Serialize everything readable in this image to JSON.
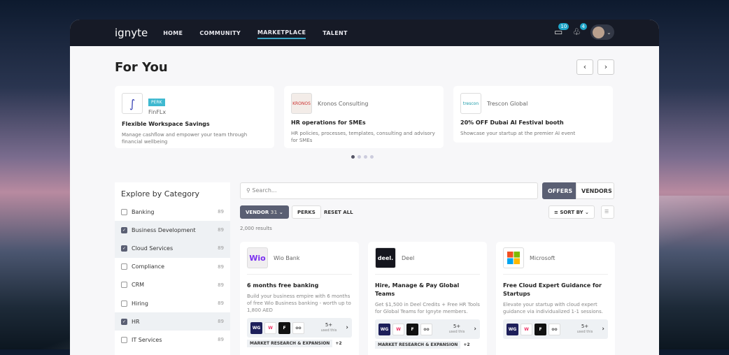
{
  "header": {
    "logo": "ignyte",
    "nav": [
      "HOME",
      "COMMUNITY",
      "MARKETPLACE",
      "TALENT"
    ],
    "active_nav": "MARKETPLACE",
    "messages_badge": "10",
    "notifications_badge": "4"
  },
  "for_you": {
    "title": "For You",
    "cards": [
      {
        "badge": "PERK",
        "vendor": "FinFLx",
        "title": "Flexible Workspace Savings",
        "desc": "Manage cashflow and empower your team through financial wellbeing"
      },
      {
        "vendor": "Kronos Consulting",
        "logo_text": "KRONOS",
        "title": "HR operations for SMEs",
        "desc": "HR policies, processes, templates, consulting and advisory for SMEs"
      },
      {
        "vendor": "Trescon Global",
        "logo_text": "trescon",
        "title": "20% OFF Dubai AI Festival booth",
        "desc": "Showcase your startup at the premier AI event"
      }
    ],
    "carousel_pages": 4,
    "active_page": 1
  },
  "sidebar": {
    "title": "Explore by Category",
    "items": [
      {
        "label": "Banking",
        "count": "89",
        "checked": false
      },
      {
        "label": "Business Development",
        "count": "89",
        "checked": true
      },
      {
        "label": "Cloud Services",
        "count": "89",
        "checked": true
      },
      {
        "label": "Compliance",
        "count": "89",
        "checked": false
      },
      {
        "label": "CRM",
        "count": "89",
        "checked": false
      },
      {
        "label": "Hiring",
        "count": "89",
        "checked": false
      },
      {
        "label": "HR",
        "count": "89",
        "checked": true
      },
      {
        "label": "IT Services",
        "count": "89",
        "checked": false
      }
    ]
  },
  "search": {
    "placeholder": "Search..."
  },
  "toggle": {
    "offers": "OFFERS",
    "vendors": "VENDORS"
  },
  "filters": {
    "vendor": "VENDOR",
    "vendor_count": "31",
    "perks": "PERKS",
    "reset": "RESET ALL",
    "sort": "SORT BY"
  },
  "results": "2,000 results",
  "offers": [
    {
      "vendor": "Wio Bank",
      "logo_text": "Wio",
      "title": "6 months free banking",
      "desc": "Build your business empire with 6 months of free Wio Business banking - worth up to 1,800 AED",
      "used": "5+",
      "used_label": "used this",
      "tag": "MARKET RESEARCH & EXPANSION",
      "more": "+2"
    },
    {
      "vendor": "Deel",
      "logo_text": "deel.",
      "title": "Hire, Manage & Pay Global Teams",
      "desc": "Get $1,500 in Deel Credits + Free HR Tools for Global Teams for Ignyte members.",
      "used": "5+",
      "used_label": "used this",
      "tag": "MARKET RESEARCH & EXPANSION",
      "more": "+2"
    },
    {
      "vendor": "Microsoft",
      "title": "Free Cloud Expert Guidance for Startups",
      "desc": "Elevate your startup with cloud expert guidance via individualized 1-1 sessions.",
      "used": "5+",
      "used_label": "used this"
    }
  ],
  "used_logos": [
    "WG",
    "W",
    "F",
    "oo"
  ]
}
